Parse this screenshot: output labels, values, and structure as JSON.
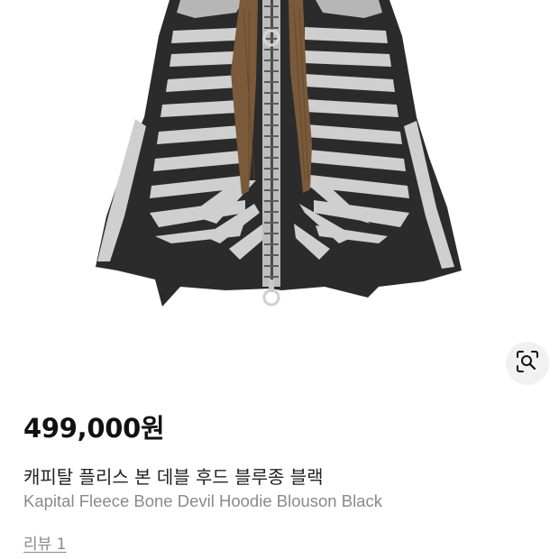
{
  "product": {
    "price": "499,000원",
    "name_ko": "캐피탈 플리스 본 데블 후드 블루종 블랙",
    "name_en": "Kapital Fleece Bone Devil Hoodie Blouson Black",
    "review_link": "리뷰 1"
  },
  "icons": {
    "image_search": "lens-search-icon"
  },
  "colors": {
    "fabric": "#2b2b2b",
    "bone": "#cfcfcf",
    "drawstring": "#7a5a3a",
    "price_text": "#111111",
    "secondary_text": "#8a8a8a"
  }
}
